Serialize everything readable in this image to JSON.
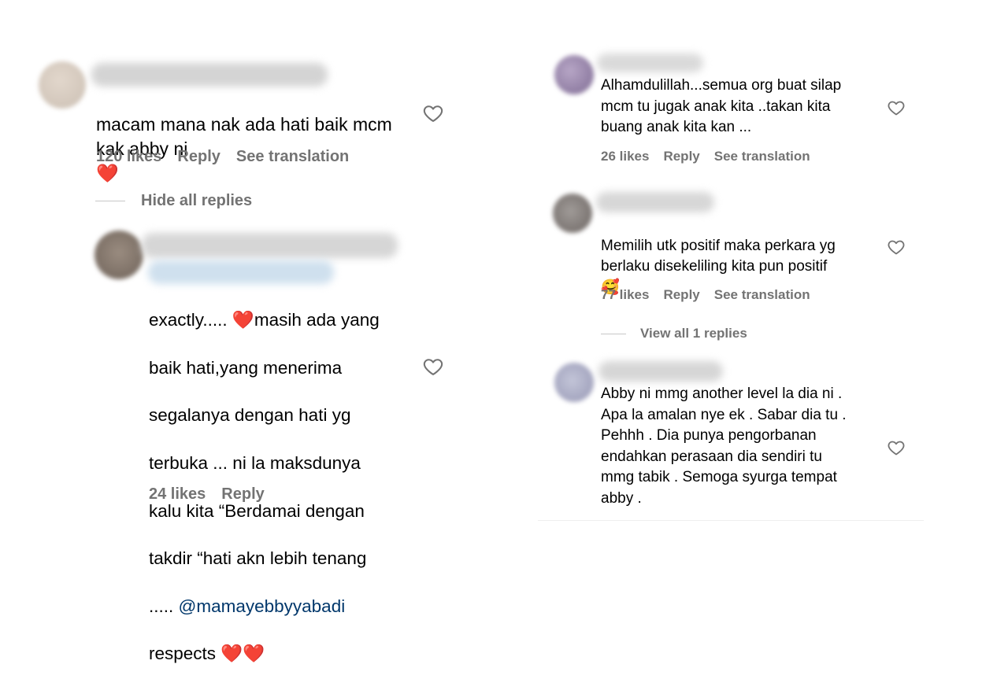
{
  "left": {
    "comment": {
      "text": "macam mana nak ada hati baik mcm\nkak abby ni",
      "emoji": "❤️",
      "likes": "120 likes",
      "reply_label": "Reply",
      "translate_label": "See translation"
    },
    "hide_replies_label": "Hide all replies",
    "reply": {
      "text_lines": [
        "exactly..... ",
        "masih ada yang",
        "baik hati,yang menerima",
        "segalanya dengan hati yg",
        "terbuka ... ni la maksdunya",
        "kalu kita “Berdamai dengan",
        "takdir “hati akn lebih tenang",
        "..... "
      ],
      "heart_emoji": "❤️",
      "mention": "@mamayebbyyabadi",
      "tail": "respects",
      "tail_emojis": "❤️❤️",
      "likes": "24 likes",
      "reply_label": "Reply"
    }
  },
  "right": {
    "comments": [
      {
        "text": "Alhamdulillah...semua org buat silap\nmcm tu jugak anak kita ..takan kita\nbuang anak kita kan ...",
        "likes": "26 likes",
        "reply_label": "Reply",
        "translate_label": "See translation"
      },
      {
        "text": "Memilih utk positif maka perkara yg\nberlaku disekeliling kita pun positif",
        "emoji": "🥰",
        "likes": "77 likes",
        "reply_label": "Reply",
        "translate_label": "See translation"
      },
      {
        "text": "Abby ni mmg another level la dia ni .\nApa la amalan nye ek . Sabar dia tu .\nPehhh . Dia punya pengorbanan\nendahkan perasaan dia sendiri tu\nmmg tabik . Semoga syurga tempat\nabby ."
      }
    ],
    "view_replies_label": "View all 1 replies"
  },
  "colors": {
    "meta_text": "#737373",
    "mention": "#00376b",
    "divider": "#c7c7c7"
  },
  "icons": {
    "like": "heart-outline-icon"
  }
}
